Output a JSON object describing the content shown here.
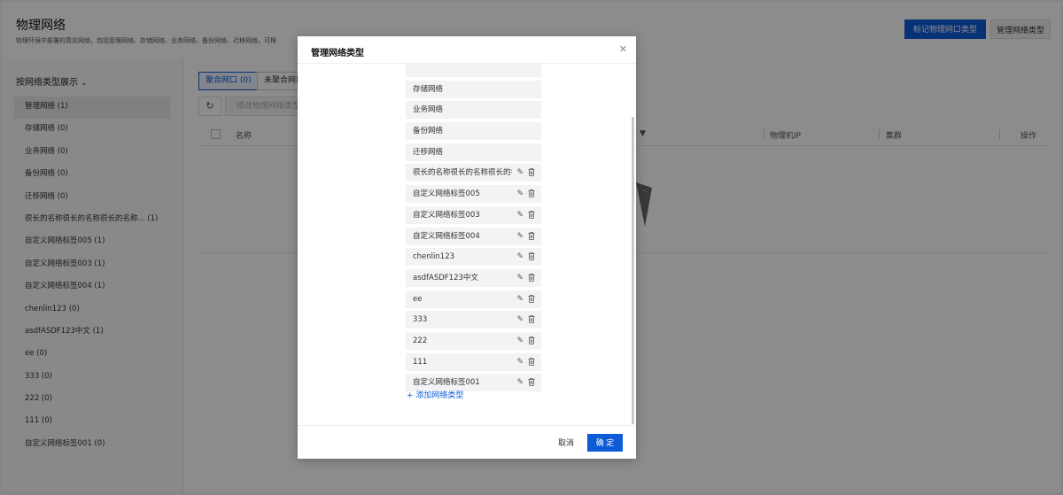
{
  "header": {
    "title": "物理网络",
    "description": "物理环境中部署的真实网络，包括管理网络、存储网络、业务网络、备份网络、迁移网络，可根",
    "mark_button": "标记物理网口类型",
    "manage_button": "管理网络类型"
  },
  "sidebar": {
    "group_by_label": "按网络类型展示",
    "items": [
      {
        "label": "管理网络 (1)",
        "active": true
      },
      {
        "label": "存储网络 (0)"
      },
      {
        "label": "业务网络 (0)"
      },
      {
        "label": "备份网络 (0)"
      },
      {
        "label": "迁移网络 (0)"
      },
      {
        "label": "很长的名称很长的名称很长的名称... (1)"
      },
      {
        "label": "自定义网络标签005 (1)"
      },
      {
        "label": "自定义网络标签003 (1)"
      },
      {
        "label": "自定义网络标签004 (1)"
      },
      {
        "label": "chenlin123 (0)"
      },
      {
        "label": "asdfASDF123中文 (1)"
      },
      {
        "label": "ee (0)"
      },
      {
        "label": "333 (0)"
      },
      {
        "label": "222 (0)"
      },
      {
        "label": "111 (0)"
      },
      {
        "label": "自定义网络标签001 (0)"
      }
    ]
  },
  "main": {
    "tabs": [
      "聚合网口 (0)",
      "未聚合网口"
    ],
    "modify_button": "修改物理网络类型",
    "columns": {
      "name": "名称",
      "ip": "物理机IP",
      "cluster": "集群",
      "action": "操作"
    }
  },
  "dialog": {
    "title": "管理网络类型",
    "items": [
      {
        "label": "",
        "editable": false
      },
      {
        "label": "存储网络",
        "editable": false
      },
      {
        "label": "业务网络",
        "editable": false
      },
      {
        "label": "备份网络",
        "editable": false
      },
      {
        "label": "迁移网络",
        "editable": false
      },
      {
        "label": "很长的名称很长的名称很长的名称",
        "editable": true
      },
      {
        "label": "自定义网络标签005",
        "editable": true
      },
      {
        "label": "自定义网络标签003",
        "editable": true
      },
      {
        "label": "自定义网络标签004",
        "editable": true
      },
      {
        "label": "chenlin123",
        "editable": true
      },
      {
        "label": "asdfASDF123中文",
        "editable": true
      },
      {
        "label": "ee",
        "editable": true
      },
      {
        "label": "333",
        "editable": true
      },
      {
        "label": "222",
        "editable": true
      },
      {
        "label": "111",
        "editable": true
      },
      {
        "label": "自定义网络标签001",
        "editable": true
      }
    ],
    "add_link": "添加网络类型",
    "cancel_button": "取消",
    "ok_button": "确 定"
  },
  "colors": {
    "primary": "#0d5bd7",
    "overlay": "rgba(0,0,0,0.45)"
  }
}
